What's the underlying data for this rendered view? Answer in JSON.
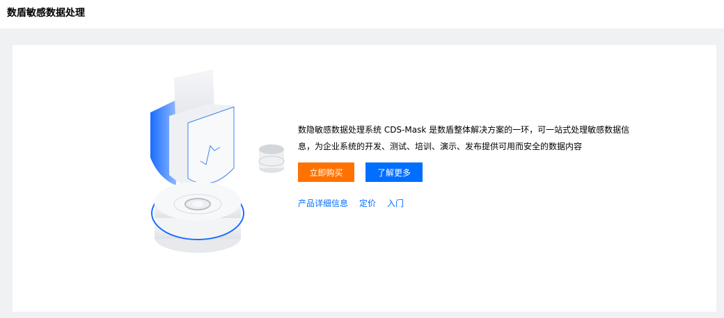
{
  "header": {
    "title": "数盾敏感数据处理"
  },
  "product": {
    "description": "数隐敏感数据处理系统 CDS-Mask 是数盾整体解决方案的一环，可一站式处理敏感数据信息，为企业系统的开发、测试、培训、演示、发布提供可用而安全的数据内容",
    "buy_label": "立即购买",
    "learn_more_label": "了解更多",
    "links": {
      "details": "产品详细信息",
      "pricing": "定价",
      "getting_started": "入门"
    }
  },
  "colors": {
    "primary": "#006eff",
    "buy": "#ff7200",
    "background": "#f0f1f3"
  },
  "icons": {
    "illustration": "data-shield-illustration"
  }
}
